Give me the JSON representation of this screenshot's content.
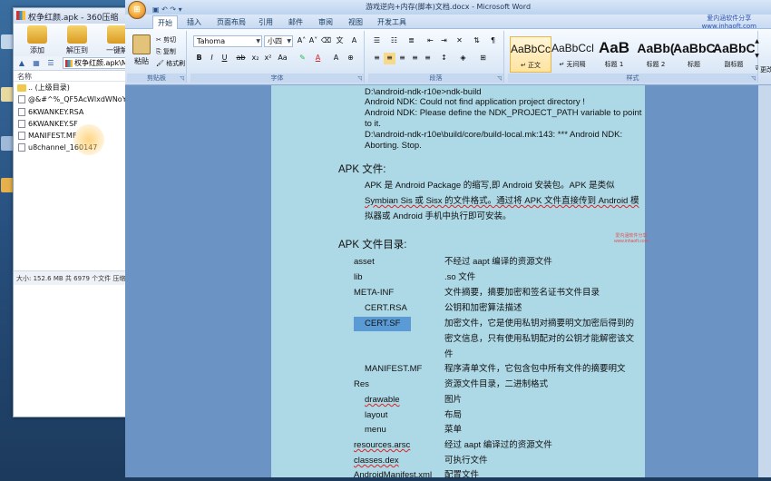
{
  "zip": {
    "title": "权争红颜.apk - 360压缩",
    "tools": [
      {
        "icon": "add-icon",
        "label": "添加"
      },
      {
        "icon": "extract-icon",
        "label": "解压到"
      },
      {
        "icon": "oneclick-icon",
        "label": "一键解"
      }
    ],
    "address": "权争红颜.apk\\M",
    "column": "名称",
    "files": [
      {
        "type": "folder",
        "name": ".. (上级目录)"
      },
      {
        "type": "file",
        "name": "@&#^%_QF5AcWlxdWNoYW5"
      },
      {
        "type": "file",
        "name": "6KWANKEY.RSA"
      },
      {
        "type": "file",
        "name": "6KWANKEY.SF"
      },
      {
        "type": "file",
        "name": "MANIFEST.MF"
      },
      {
        "type": "file",
        "name": "u8channel_160147"
      }
    ],
    "status": "大小: 152.6 MB 共 6979 个文件 压缩"
  },
  "word": {
    "title": "游戏逆向+内存(脚本)文档.docx - Microsoft Word",
    "orb": "⊞",
    "qat": "▣ ↶ ↷ ▾",
    "logo_line1": "爱内涵软件分享",
    "logo_line2": "www.inhaoft.com",
    "tabs": [
      "开始",
      "插入",
      "页面布局",
      "引用",
      "邮件",
      "审阅",
      "视图",
      "开发工具"
    ],
    "clipboard": {
      "paste": "粘贴",
      "cut": "✂ 剪切",
      "copy": "⎘ 复制",
      "format": "🖌 格式刷",
      "group": "剪贴板"
    },
    "font": {
      "name": "Tahoma",
      "size": "小四",
      "group": "字体"
    },
    "paragraph": {
      "group": "段落"
    },
    "styles": {
      "group": "样式",
      "items": [
        {
          "preview": "AaBbCcD",
          "label": "↵ 正文"
        },
        {
          "preview": "AaBbCcD",
          "label": "↵ 无间隔"
        },
        {
          "preview": "AaB",
          "label": "标题 1"
        },
        {
          "preview": "AaBb(",
          "label": "标题 2"
        },
        {
          "preview": "AaBbC",
          "label": "标题"
        },
        {
          "preview": "AaBbC",
          "label": "副标题"
        }
      ],
      "more": "更改"
    }
  },
  "doc": {
    "ndk_lines": [
      "D:\\android-ndk-r10e>ndk-build",
      "Android NDK: Could not find application project directory !",
      "Android NDK: Please define the NDK_PROJECT_PATH variable to point",
      "to it.",
      "D:\\android-ndk-r10e\\build/core/build-local.mk:143: *** Android NDK:",
      "Aborting.  Stop."
    ],
    "apk_heading": "APK 文件:",
    "apk_desc": [
      "APK 是 Android Package 的缩写,即 Android 安装包。APK 是类似",
      "Symbian Sis 或 Sisx 的文件格式。通过将 APK 文件直接传到 Android 模",
      "拟器或 Android 手机中执行即可安装。"
    ],
    "dir_heading": "APK 文件目录:",
    "watermark1": "爱内涵软件分享",
    "watermark2": "www.inhaoft.com",
    "entries": [
      {
        "name": "asset",
        "desc": [
          "不经过 aapt 编译的资源文件"
        ]
      },
      {
        "name": "lib",
        "desc": [
          ".so 文件"
        ]
      },
      {
        "name": "META-INF",
        "desc": [
          "文件摘要，摘要加密和签名证书文件目录"
        ]
      },
      {
        "name": "CERT.RSA",
        "desc": [
          "公钥和加密算法描述"
        ]
      },
      {
        "name": "CERT.SF",
        "desc": [
          "加密文件，它是使用私钥对摘要明文加密后得到的",
          "密文信息，只有使用私钥配对的公钥才能解密该文",
          "件"
        ]
      },
      {
        "name": "MANIFEST.MF",
        "desc": [
          "程序清单文件，它包含包中所有文件的摘要明文"
        ]
      },
      {
        "name": "Res",
        "desc": [
          "资源文件目录，二进制格式"
        ]
      },
      {
        "name": "drawable",
        "desc": [
          "图片"
        ]
      },
      {
        "name": "layout",
        "desc": [
          "布局"
        ]
      },
      {
        "name": "menu",
        "desc": [
          "菜单"
        ]
      },
      {
        "name": "resources.arsc",
        "desc": [
          "经过 aapt 编译过的资源文件"
        ]
      },
      {
        "name": "classes.dex",
        "desc": [
          "可执行文件"
        ]
      },
      {
        "name": "AndroidManifest.xml",
        "desc": [
          "配置文件"
        ]
      }
    ]
  }
}
